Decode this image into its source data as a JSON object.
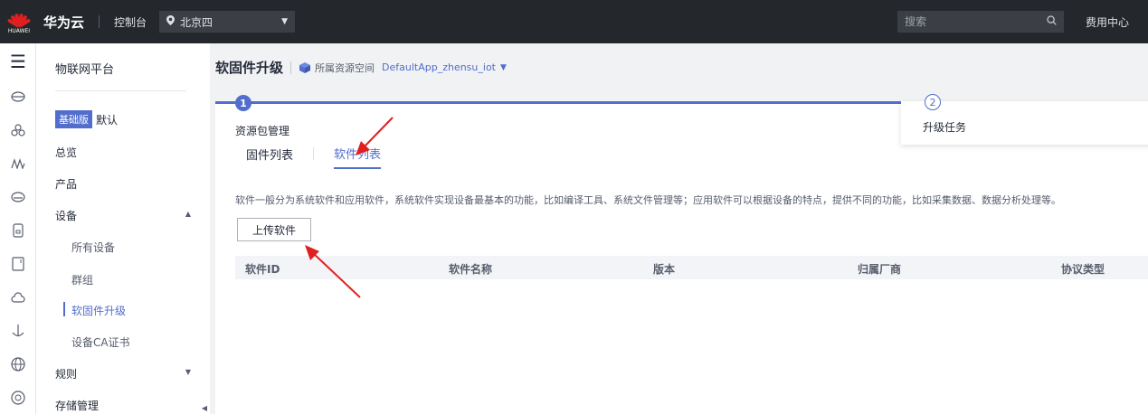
{
  "topbar": {
    "logo_text": "HUAWEI",
    "brand": "华为云",
    "console": "控制台",
    "region": "北京四",
    "search_placeholder": "搜索",
    "fee_center": "费用中心"
  },
  "rail": {
    "icons": [
      "menu-icon",
      "cloud-disk-icon",
      "network-icon",
      "monitor-icon",
      "database-icon",
      "server-icon",
      "device-icon",
      "cloud-icon",
      "anchor-icon",
      "globe-icon",
      "circle-icon"
    ]
  },
  "nav": {
    "title": "物联网平台",
    "edition_badge": "基础版",
    "edition_default": "默认",
    "items": {
      "overview": "总览",
      "products": "产品",
      "devices": "设备",
      "rules": "规则",
      "storage": "存储管理"
    },
    "device_sub": {
      "all_devices": "所有设备",
      "groups": "群组",
      "firmware_upgrade": "软固件升级",
      "ca_cert": "设备CA证书"
    }
  },
  "main": {
    "title": "软固件升级",
    "space_label": "所属资源空间",
    "space_value": "DefaultApp_zhensu_iot",
    "steps": [
      {
        "number": "1",
        "label": "资源包管理"
      },
      {
        "number": "2",
        "label": "升级任务"
      }
    ],
    "tabs": {
      "firmware": "固件列表",
      "software": "软件列表"
    },
    "description": "软件一般分为系统软件和应用软件，系统软件实现设备最基本的功能，比如编译工具、系统文件管理等；应用软件可以根据设备的特点，提供不同的功能，比如采集数据、数据分析处理等。",
    "upload_button": "上传软件",
    "table_headers": [
      "软件ID",
      "软件名称",
      "版本",
      "归属厂商",
      "协议类型"
    ]
  },
  "colors": {
    "accent": "#526ecc",
    "topbar": "#24272b",
    "annotation_arrow": "#e02020"
  }
}
